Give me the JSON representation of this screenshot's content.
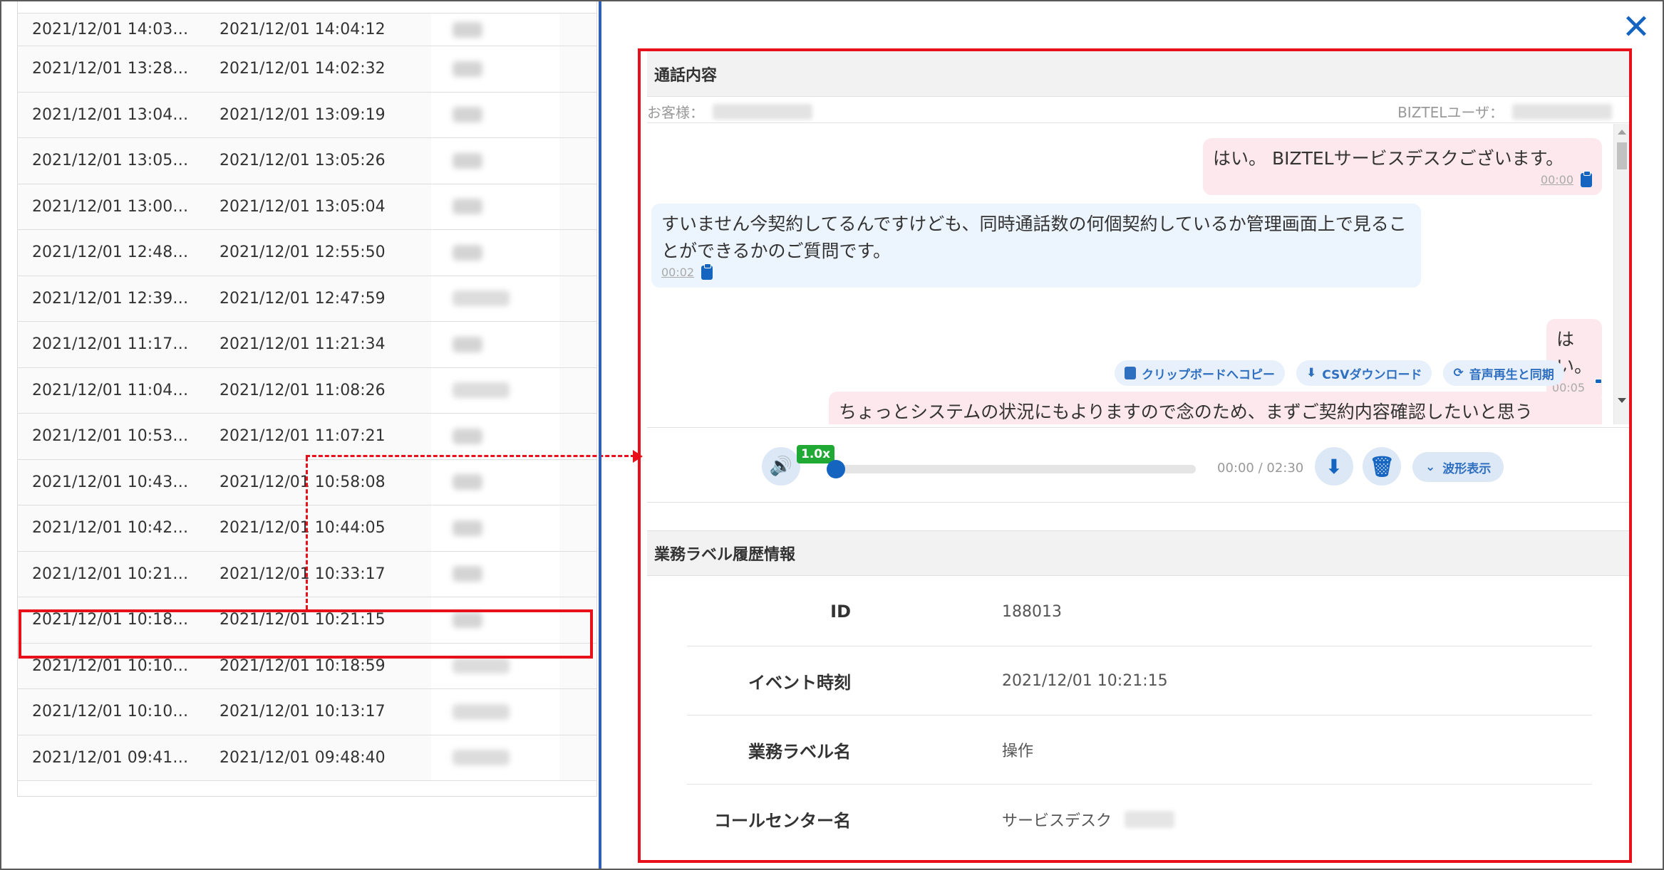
{
  "call_list": {
    "rows": [
      {
        "start": "2021/12/01 14:03…",
        "end": "2021/12/01 14:04:12"
      },
      {
        "start": "2021/12/01 13:28…",
        "end": "2021/12/01 14:02:32"
      },
      {
        "start": "2021/12/01 13:04…",
        "end": "2021/12/01 13:09:19"
      },
      {
        "start": "2021/12/01 13:05…",
        "end": "2021/12/01 13:05:26"
      },
      {
        "start": "2021/12/01 13:00…",
        "end": "2021/12/01 13:05:04"
      },
      {
        "start": "2021/12/01 12:48…",
        "end": "2021/12/01 12:55:50"
      },
      {
        "start": "2021/12/01 12:39…",
        "end": "2021/12/01 12:47:59"
      },
      {
        "start": "2021/12/01 11:17…",
        "end": "2021/12/01 11:21:34"
      },
      {
        "start": "2021/12/01 11:04…",
        "end": "2021/12/01 11:08:26"
      },
      {
        "start": "2021/12/01 10:53…",
        "end": "2021/12/01 11:07:21"
      },
      {
        "start": "2021/12/01 10:43…",
        "end": "2021/12/01 10:58:08"
      },
      {
        "start": "2021/12/01 10:42…",
        "end": "2021/12/01 10:44:05"
      },
      {
        "start": "2021/12/01 10:21…",
        "end": "2021/12/01 10:33:17"
      },
      {
        "start": "2021/12/01 10:18…",
        "end": "2021/12/01 10:21:15"
      },
      {
        "start": "2021/12/01 10:10…",
        "end": "2021/12/01 10:18:59"
      },
      {
        "start": "2021/12/01 10:10…",
        "end": "2021/12/01 10:13:17"
      },
      {
        "start": "2021/12/01 09:41…",
        "end": "2021/12/01 09:48:40"
      }
    ]
  },
  "detail": {
    "close_icon": "✕",
    "talk_section_title": "通話内容",
    "customer_label": "お客様：",
    "user_label": "BIZTELユーザ：",
    "messages": [
      {
        "side": "right",
        "text": "はい。 BIZTELサービスデスクございます。",
        "time": "00:00"
      },
      {
        "side": "left",
        "text": "すいません今契約してるんですけども、同時通話数の何個契約しているか管理画面上で見ることができるかのご質問です。",
        "time": "00:02"
      },
      {
        "side": "right",
        "text": "はい。",
        "time": "00:05"
      },
      {
        "side": "right",
        "text": "ちょっとシステムの状況にもよりますので念のため、まずご契約内容確認したいと思う",
        "time": ""
      }
    ],
    "tools": {
      "clipboard": "クリップボードへコピー",
      "csv": "CSVダウンロード",
      "sync": "音声再生と同期"
    },
    "player": {
      "speed": "1.0x",
      "time": "00:00 / 02:30",
      "progress": 0,
      "wave_label": "波形表示"
    },
    "label_section_title": "業務ラベル履歴情報",
    "info": [
      {
        "key": "ID",
        "value": "188013"
      },
      {
        "key": "イベント時刻",
        "value": "2021/12/01 10:21:15"
      },
      {
        "key": "業務ラベル名",
        "value": "操作"
      },
      {
        "key": "コールセンター名",
        "value": "サービスデスク"
      }
    ]
  }
}
